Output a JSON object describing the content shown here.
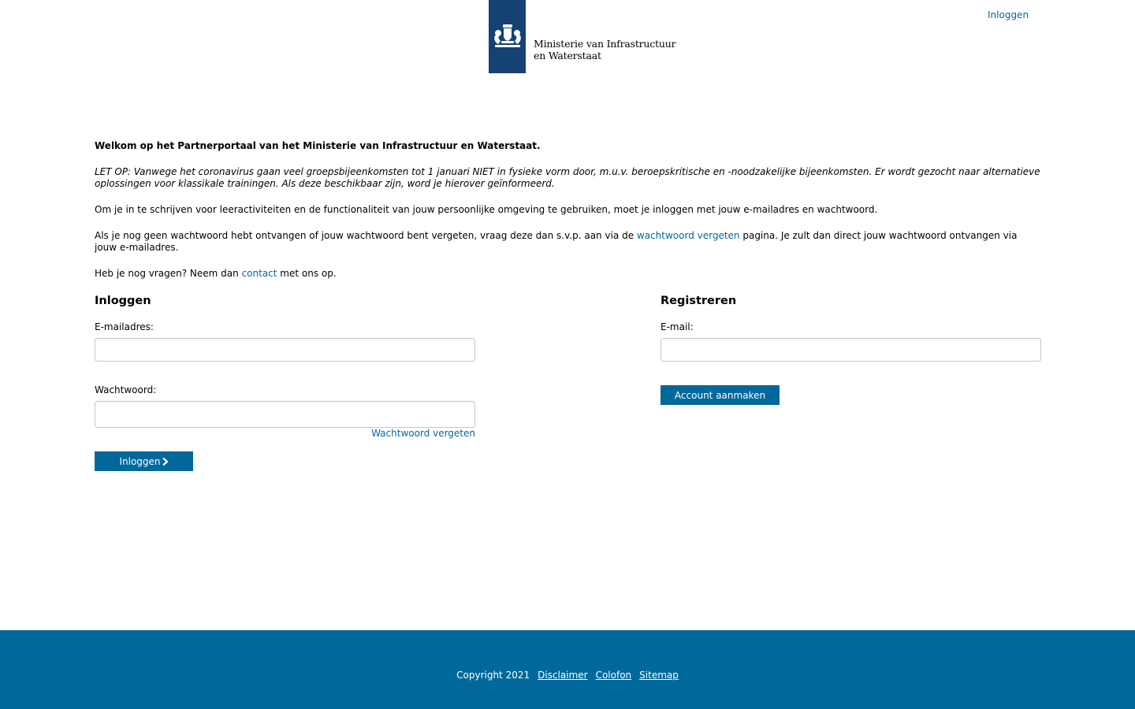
{
  "header": {
    "logo_line1": "Ministerie van Infrastructuur",
    "logo_line2": "en Waterstaat",
    "login_link": "Inloggen",
    "brand_color": "#154273"
  },
  "intro": {
    "welcome": "Welkom op het Partnerportaal van het Ministerie van Infrastructuur en Waterstaat.",
    "notice": "LET OP: Vanwege het coronavirus gaan veel groepsbijeenkomsten tot 1 januari NIET in fysieke vorm door, m.u.v. beroepskritische en -noodzakelijke bijeenkomsten. Er wordt gezocht naar alternatieve oplossingen voor klassikale trainingen. Als deze beschikbaar zijn, word je hierover geïnformeerd.",
    "instructions": "Om je in te schrijven voor leeractiviteiten en de functionaliteit van jouw persoonlijke omgeving te gebruiken, moet je inloggen met jouw e-mailadres en wachtwoord.",
    "password_before": "Als je nog geen wachtwoord hebt ontvangen of jouw wachtwoord bent vergeten, vraag deze dan s.v.p. aan via de ",
    "password_link": "wachtwoord vergeten",
    "password_after": " pagina. Je zult dan direct jouw wachtwoord ontvangen via jouw e-mailadres.",
    "questions_before": "Heb je nog vragen? Neem dan ",
    "questions_link": "contact",
    "questions_after": " met ons op."
  },
  "login": {
    "title": "Inloggen",
    "email_label": "E-mailadres:",
    "email_value": "",
    "password_label": "Wachtwoord:",
    "password_value": "",
    "forgot_link": "Wachtwoord vergeten",
    "submit_label": "Inloggen",
    "submit_icon": "chevron-right-icon"
  },
  "register": {
    "title": "Registreren",
    "email_label": "E-mail:",
    "email_value": "",
    "submit_label": "Account aanmaken"
  },
  "footer": {
    "copyright": "Copyright 2021",
    "links": [
      "Disclaimer",
      "Colofon",
      "Sitemap"
    ]
  },
  "colors": {
    "accent": "#01689b",
    "footer_bg": "#01689b"
  }
}
